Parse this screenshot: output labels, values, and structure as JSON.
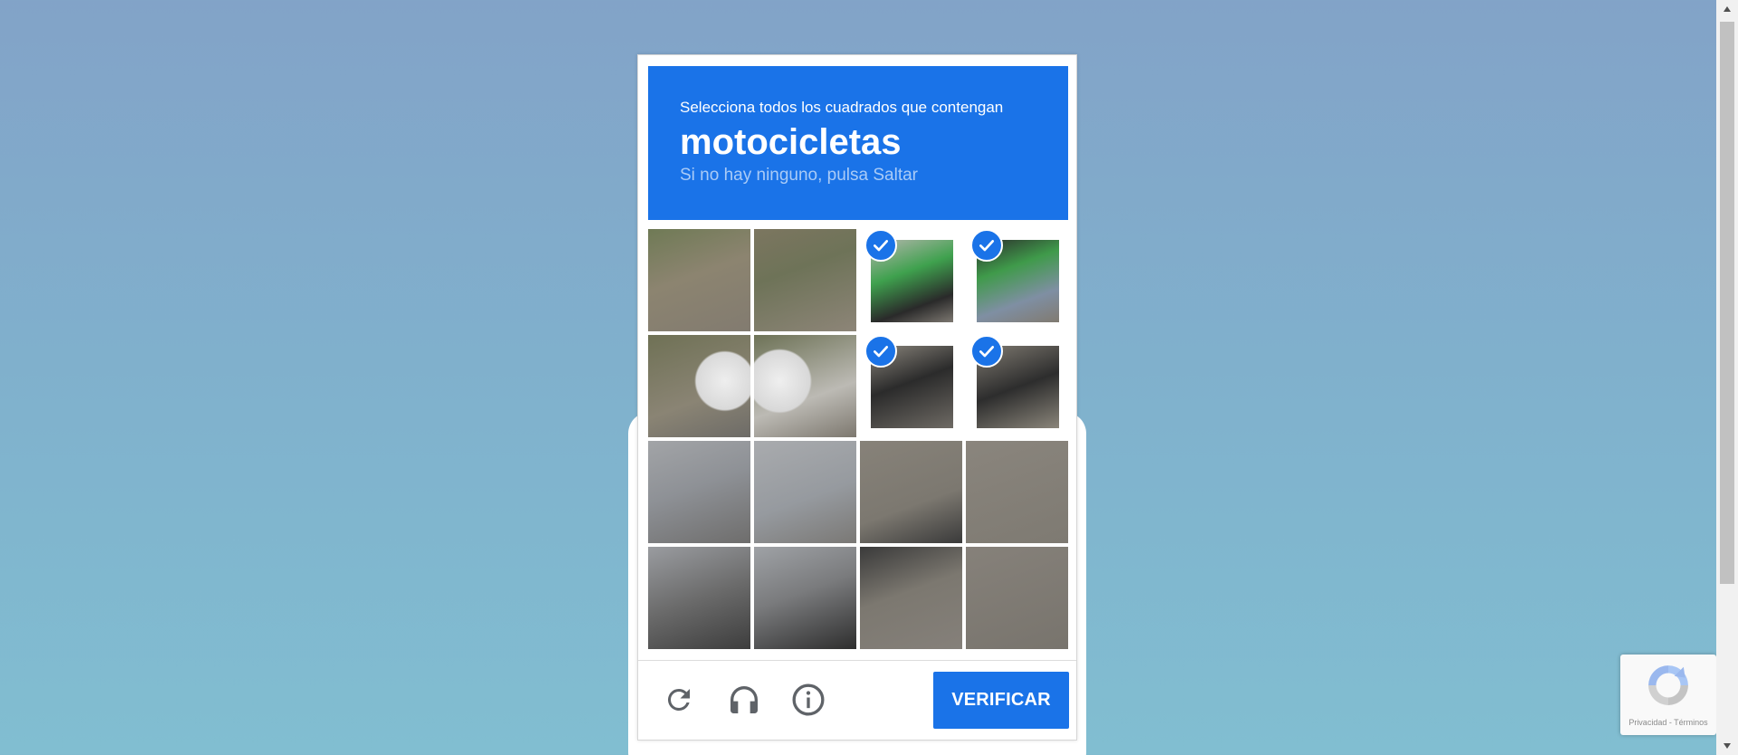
{
  "challenge": {
    "instruction": "Selecciona todos los cuadrados que contengan",
    "target": "motocicletas",
    "hint": "Si no hay ninguno, pulsa Saltar"
  },
  "grid": {
    "rows": 4,
    "columns": 4,
    "tiles": [
      {
        "row": 0,
        "col": 0,
        "selected": false
      },
      {
        "row": 0,
        "col": 1,
        "selected": false
      },
      {
        "row": 0,
        "col": 2,
        "selected": true
      },
      {
        "row": 0,
        "col": 3,
        "selected": true
      },
      {
        "row": 1,
        "col": 0,
        "selected": false
      },
      {
        "row": 1,
        "col": 1,
        "selected": false
      },
      {
        "row": 1,
        "col": 2,
        "selected": true
      },
      {
        "row": 1,
        "col": 3,
        "selected": true
      },
      {
        "row": 2,
        "col": 0,
        "selected": false
      },
      {
        "row": 2,
        "col": 1,
        "selected": false
      },
      {
        "row": 2,
        "col": 2,
        "selected": false
      },
      {
        "row": 2,
        "col": 3,
        "selected": false
      },
      {
        "row": 3,
        "col": 0,
        "selected": false
      },
      {
        "row": 3,
        "col": 1,
        "selected": false
      },
      {
        "row": 3,
        "col": 2,
        "selected": false
      },
      {
        "row": 3,
        "col": 3,
        "selected": false
      }
    ]
  },
  "footer": {
    "icons": [
      "reload-icon",
      "headphones-icon",
      "info-icon"
    ],
    "verify_label": "VERIFICAR"
  },
  "badge": {
    "legal": "Privacidad - Términos"
  },
  "colors": {
    "accent": "#1a73e8",
    "hint": "#a9cbf7",
    "icon": "#5f6368"
  }
}
